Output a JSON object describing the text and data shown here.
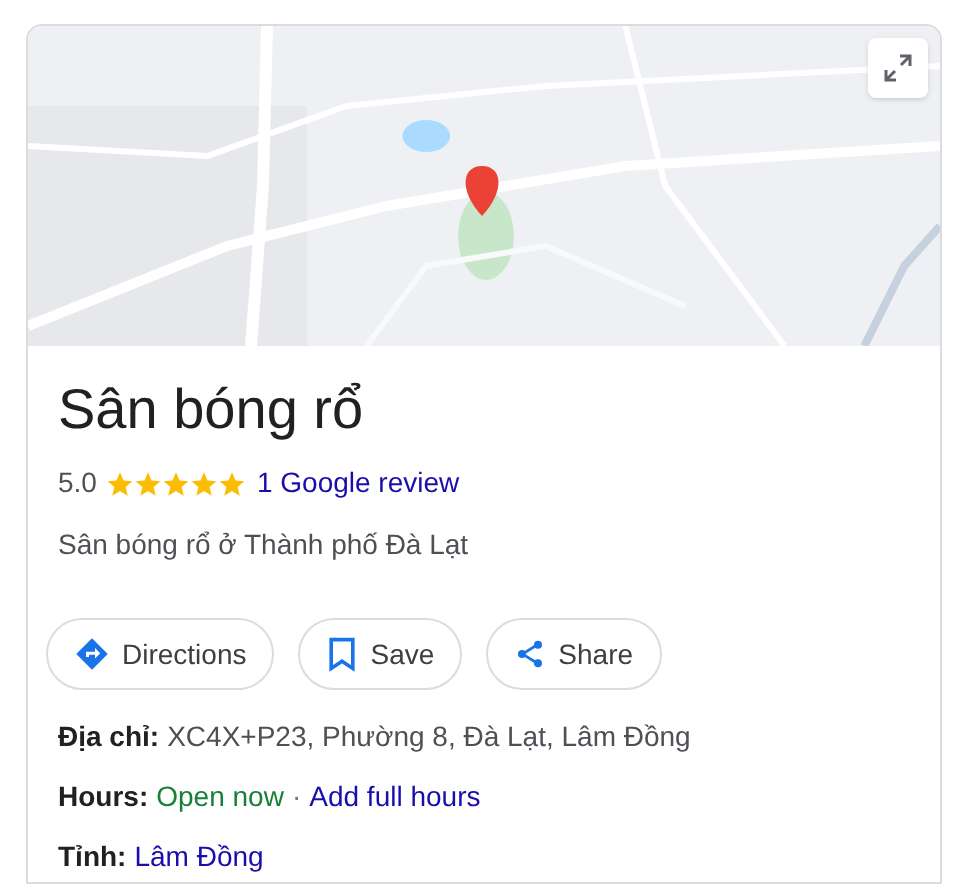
{
  "place": {
    "title": "Sân bóng rổ",
    "rating": "5.0",
    "stars": 5,
    "review_link": "1 Google review",
    "subtitle": "Sân bóng rổ ở Thành phố Đà Lạt"
  },
  "actions": [
    {
      "kind": "directions",
      "label": "Directions"
    },
    {
      "kind": "save",
      "label": "Save"
    },
    {
      "kind": "share",
      "label": "Share"
    }
  ],
  "facts": [
    {
      "label": "Địa chỉ:",
      "parts": [
        {
          "kind": "text",
          "text": "XC4X+P23, Phường 8, Đà Lạt, Lâm Đồng"
        }
      ]
    },
    {
      "label": "Hours:",
      "parts": [
        {
          "kind": "status",
          "text": "Open now"
        },
        {
          "kind": "separator",
          "text": "·"
        },
        {
          "kind": "link",
          "text": "Add full hours"
        }
      ]
    },
    {
      "label": "Tỉnh:",
      "parts": [
        {
          "kind": "link",
          "text": "Lâm Đồng"
        }
      ]
    }
  ]
}
